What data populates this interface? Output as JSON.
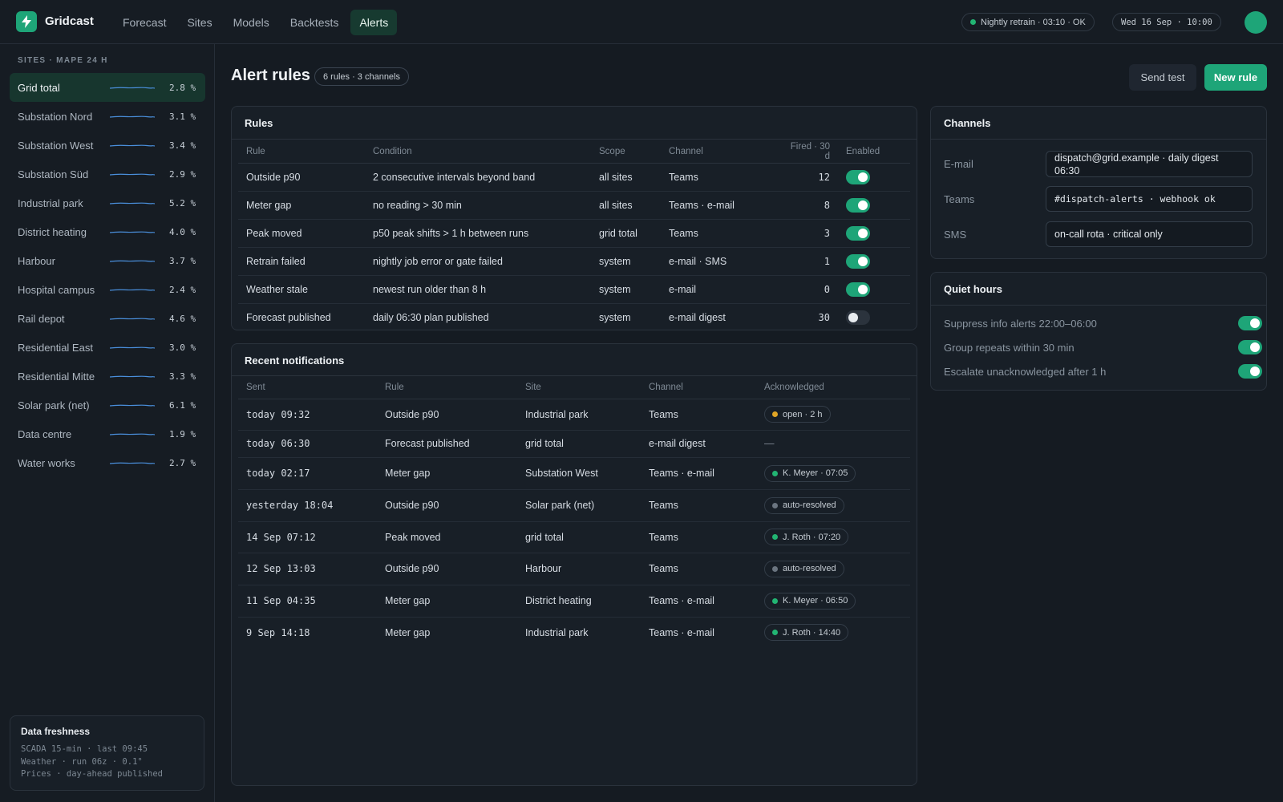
{
  "app": {
    "name": "Gridcast",
    "brand_color": "#1ea578"
  },
  "nav": {
    "tabs": [
      "Forecast",
      "Sites",
      "Models",
      "Backtests",
      "Alerts"
    ],
    "active": "Alerts"
  },
  "status": {
    "retrain": "Nightly retrain · 03:10 · OK",
    "datetime": "Wed 16 Sep · 10:00"
  },
  "sidebar": {
    "heading": "SITES · MAPE 24 H",
    "sites": [
      {
        "name": "Grid total",
        "mape": "2.8 %"
      },
      {
        "name": "Substation Nord",
        "mape": "3.1 %"
      },
      {
        "name": "Substation West",
        "mape": "3.4 %"
      },
      {
        "name": "Substation Süd",
        "mape": "2.9 %"
      },
      {
        "name": "Industrial park",
        "mape": "5.2 %"
      },
      {
        "name": "District heating",
        "mape": "4.0 %"
      },
      {
        "name": "Harbour",
        "mape": "3.7 %"
      },
      {
        "name": "Hospital campus",
        "mape": "2.4 %"
      },
      {
        "name": "Rail depot",
        "mape": "4.6 %"
      },
      {
        "name": "Residential East",
        "mape": "3.0 %"
      },
      {
        "name": "Residential Mitte",
        "mape": "3.3 %"
      },
      {
        "name": "Solar park (net)",
        "mape": "6.1 %"
      },
      {
        "name": "Data centre",
        "mape": "1.9 %"
      },
      {
        "name": "Water works",
        "mape": "2.7 %"
      }
    ],
    "freshness": {
      "title": "Data freshness",
      "lines": [
        "SCADA 15-min · last 09:45",
        "Weather · run 06z · 0.1°",
        "Prices · day-ahead published"
      ]
    }
  },
  "main": {
    "title": "Alert rules",
    "count": "6 rules · 3 channels",
    "send_test": "Send test",
    "new_rule": "New rule"
  },
  "rules": {
    "title": "Rules",
    "headers": [
      "Rule",
      "Condition",
      "Scope",
      "Channel",
      "Fired · 30 d",
      "Enabled"
    ],
    "rows": [
      {
        "rule": "Outside p90",
        "condition": "2 consecutive intervals beyond band",
        "scope": "all sites",
        "channel": "Teams",
        "fired": "12",
        "enabled": true
      },
      {
        "rule": "Meter gap",
        "condition": "no reading > 30 min",
        "scope": "all sites",
        "channel": "Teams · e-mail",
        "fired": "8",
        "enabled": true
      },
      {
        "rule": "Peak moved",
        "condition": "p50 peak shifts > 1 h between runs",
        "scope": "grid total",
        "channel": "Teams",
        "fired": "3",
        "enabled": true
      },
      {
        "rule": "Retrain failed",
        "condition": "nightly job error or gate failed",
        "scope": "system",
        "channel": "e-mail · SMS",
        "fired": "1",
        "enabled": true
      },
      {
        "rule": "Weather stale",
        "condition": "newest run older than 8 h",
        "scope": "system",
        "channel": "e-mail",
        "fired": "0",
        "enabled": true
      },
      {
        "rule": "Forecast published",
        "condition": "daily 06:30 plan published",
        "scope": "system",
        "channel": "e-mail digest",
        "fired": "30",
        "enabled": false
      }
    ]
  },
  "notifications": {
    "title": "Recent notifications",
    "headers": [
      "Sent",
      "Rule",
      "Site",
      "Channel",
      "Acknowledged"
    ],
    "rows": [
      {
        "sent": "today 09:32",
        "rule": "Outside p90",
        "site": "Industrial park",
        "channel": "Teams",
        "ack": "open · 2 h",
        "ack_color": "#e0a526"
      },
      {
        "sent": "today 06:30",
        "rule": "Forecast published",
        "site": "grid total",
        "channel": "e-mail digest",
        "ack": "—",
        "ack_color": ""
      },
      {
        "sent": "today 02:17",
        "rule": "Meter gap",
        "site": "Substation West",
        "channel": "Teams · e-mail",
        "ack": "K. Meyer · 07:05",
        "ack_color": "#22b573"
      },
      {
        "sent": "yesterday 18:04",
        "rule": "Outside p90",
        "site": "Solar park (net)",
        "channel": "Teams",
        "ack": "auto-resolved",
        "ack_color": "#6b7580"
      },
      {
        "sent": "14 Sep 07:12",
        "rule": "Peak moved",
        "site": "grid total",
        "channel": "Teams",
        "ack": "J. Roth · 07:20",
        "ack_color": "#22b573"
      },
      {
        "sent": "12 Sep 13:03",
        "rule": "Outside p90",
        "site": "Harbour",
        "channel": "Teams",
        "ack": "auto-resolved",
        "ack_color": "#6b7580"
      },
      {
        "sent": "11 Sep 04:35",
        "rule": "Meter gap",
        "site": "District heating",
        "channel": "Teams · e-mail",
        "ack": "K. Meyer · 06:50",
        "ack_color": "#22b573"
      },
      {
        "sent": "9 Sep 14:18",
        "rule": "Meter gap",
        "site": "Industrial park",
        "channel": "Teams · e-mail",
        "ack": "J. Roth · 14:40",
        "ack_color": "#22b573"
      }
    ]
  },
  "channels": {
    "title": "Channels",
    "items": [
      {
        "label": "E-mail",
        "value": "dispatch@grid.example · daily digest 06:30"
      },
      {
        "label": "Teams",
        "value": "#dispatch-alerts · webhook ok"
      },
      {
        "label": "SMS",
        "value": "on-call rota · critical only"
      }
    ]
  },
  "quiet_hours": {
    "title": "Quiet hours",
    "items": [
      {
        "label": "Suppress info alerts 22:00–06:00",
        "enabled": true
      },
      {
        "label": "Group repeats within 30 min",
        "enabled": true
      },
      {
        "label": "Escalate unacknowledged after 1 h",
        "enabled": true
      }
    ]
  }
}
